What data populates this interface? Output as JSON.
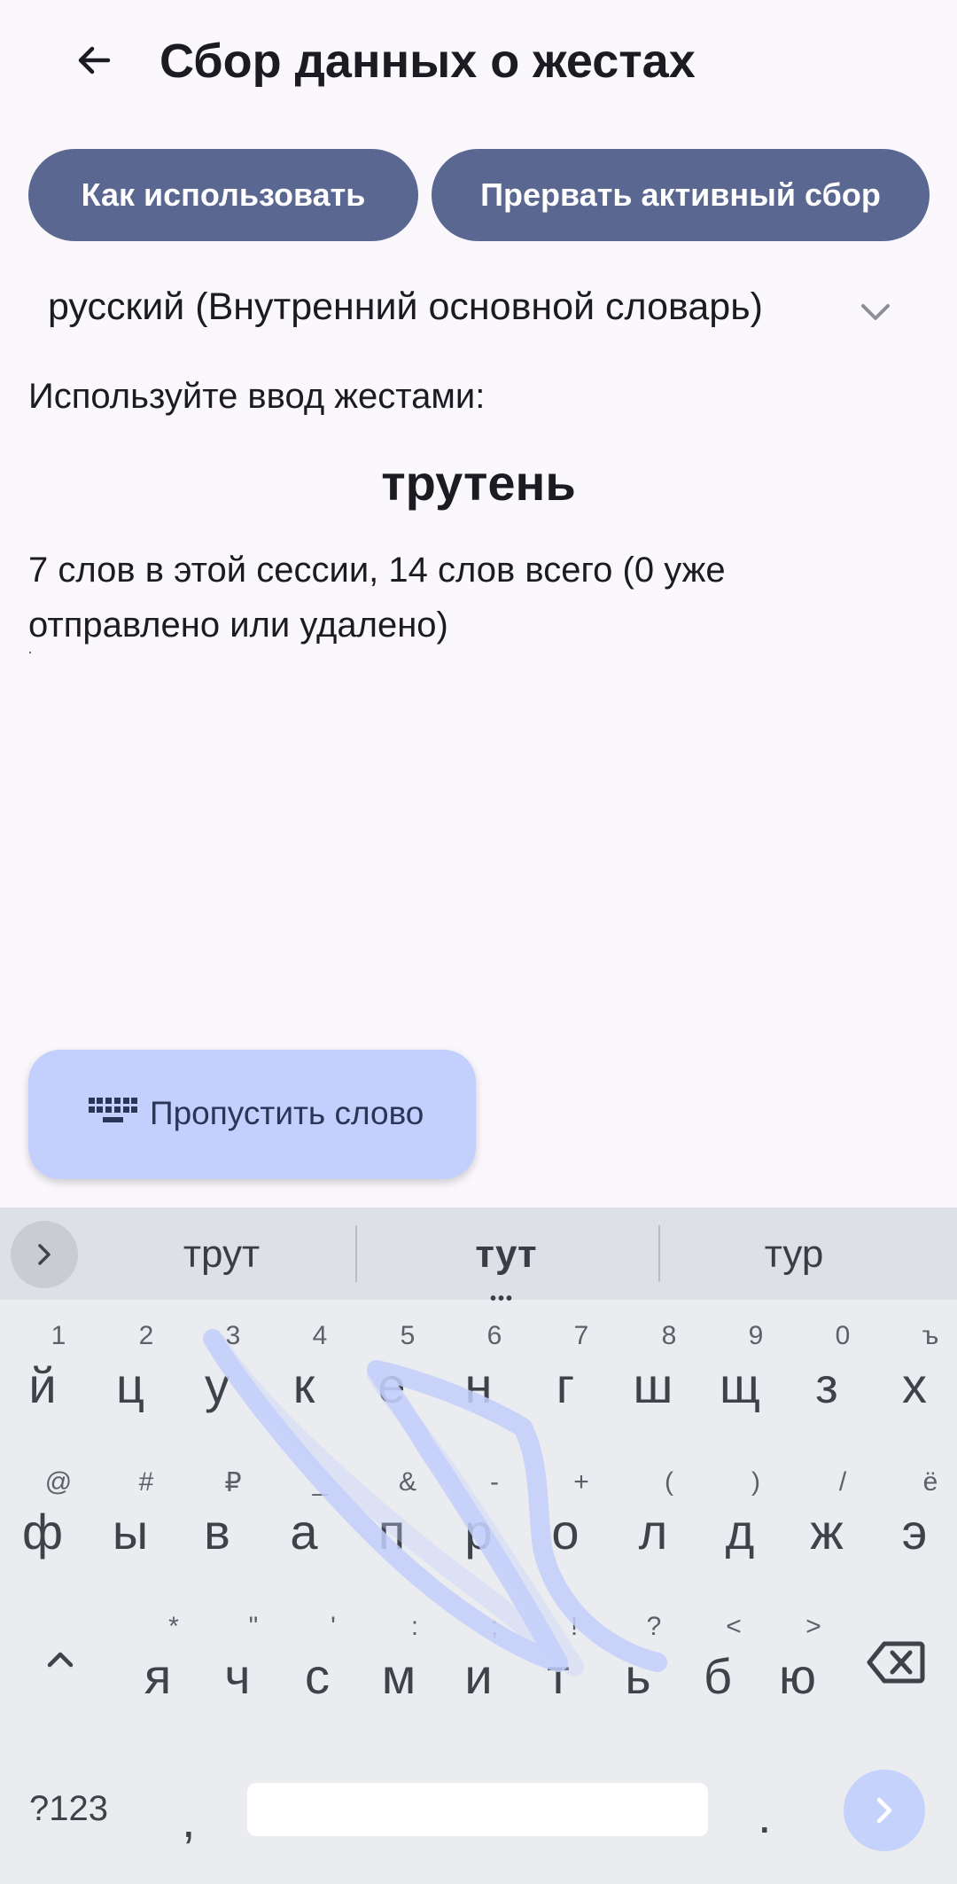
{
  "header": {
    "title": "Сбор данных о жестах"
  },
  "actions": {
    "how_to_use": "Как использовать",
    "stop_collection": "Прервать активный сбор"
  },
  "language_select": {
    "value": "русский (Внутренний основной словарь)"
  },
  "prompt": "Используйте ввод жестами:",
  "target_word": "трутень",
  "session_stats": "7 слов в этой сессии, 14 слов всего (0 уже отправлено или удалено)",
  "skip_word_button": {
    "label": "Пропустить слово",
    "icon": "keyboard-icon"
  },
  "keyboard": {
    "suggestions": [
      "трут",
      "тут",
      "тур"
    ],
    "rows": [
      {
        "keys": [
          "й",
          "ц",
          "у",
          "к",
          "е",
          "н",
          "г",
          "ш",
          "щ",
          "з",
          "х"
        ],
        "hints": [
          "1",
          "2",
          "3",
          "4",
          "5",
          "6",
          "7",
          "8",
          "9",
          "0",
          "ъ"
        ]
      },
      {
        "keys": [
          "ф",
          "ы",
          "в",
          "а",
          "п",
          "р",
          "о",
          "л",
          "д",
          "ж",
          "э"
        ],
        "hints": [
          "@",
          "#",
          "₽",
          "_",
          "&",
          "-",
          "+",
          "(",
          ")",
          "/",
          "ё"
        ]
      },
      {
        "keys": [
          "я",
          "ч",
          "с",
          "м",
          "и",
          "т",
          "ь",
          "б",
          "ю"
        ],
        "hints": [
          "*",
          "\"",
          "'",
          ":",
          ";",
          "!",
          "?",
          "<",
          ">"
        ]
      }
    ],
    "symbols_key": "?123",
    "comma_key": ",",
    "period_key": ".",
    "accent_color": "#c3cffc"
  }
}
